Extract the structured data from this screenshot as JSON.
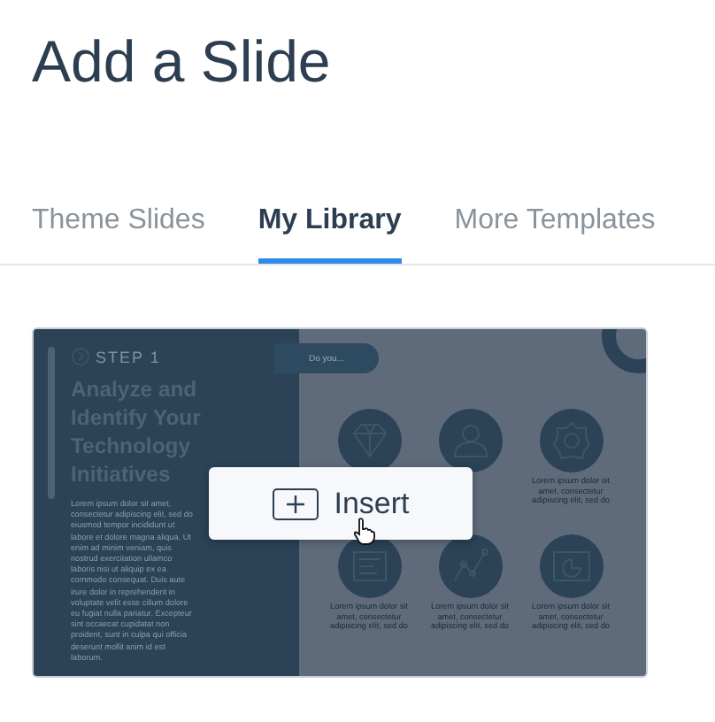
{
  "page": {
    "title": "Add a Slide"
  },
  "tabs": [
    {
      "label": "Theme Slides",
      "selected": false
    },
    {
      "label": "My Library",
      "selected": true
    },
    {
      "label": "More Templates",
      "selected": false
    }
  ],
  "slide": {
    "step": "STEP 1",
    "heading": "Analyze and Identify Your Technology Initiatives",
    "pill": "Do you...",
    "body": "Lorem ipsum dolor sit amet, consectetur adipiscing elit, sed do eiusmod tempor incididunt ut labore et dolore magna aliqua. Ut enim ad minim veniam, quis nostrud exercitation ullamco laboris nisi ut aliquip ex ea commodo consequat. Duis aute irure dolor in reprehenderit in voluptate velit esse cillum dolore eu fugiat nulla pariatur. Excepteur sint occaecat cupidatat non proident, sunt in culpa qui officia deserunt mollit anim id est laborum.",
    "features": [
      {
        "kind": "diamond"
      },
      {
        "kind": "person"
      },
      {
        "kind": "badge",
        "caption": "Lorem ipsum dolor sit amet, consectetur adipiscing elit, sed do"
      },
      {
        "kind": "document",
        "caption": "Lorem ipsum dolor sit amet, consectetur adipiscing elit, sed do"
      },
      {
        "kind": "graph",
        "caption": "Lorem ipsum dolor sit amet, consectetur adipiscing elit, sed do"
      },
      {
        "kind": "chart",
        "caption": "Lorem ipsum dolor sit amet, consectetur adipiscing elit, sed do"
      }
    ]
  },
  "insert_button": {
    "label": "Insert"
  }
}
